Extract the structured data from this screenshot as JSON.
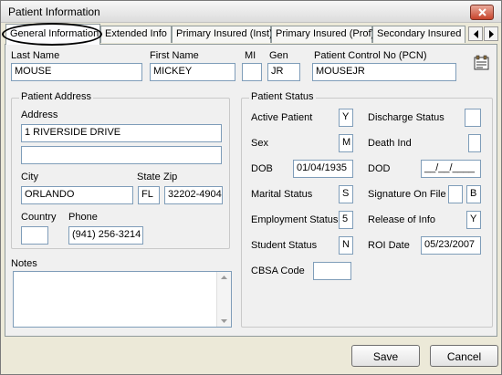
{
  "window": {
    "title": "Patient Information"
  },
  "tabs": [
    {
      "label": "General Information",
      "active": true
    },
    {
      "label": "Extended Info"
    },
    {
      "label": "Primary Insured (Inst)"
    },
    {
      "label": "Primary Insured (Prof)"
    },
    {
      "label": "Secondary Insured"
    }
  ],
  "name_row": {
    "last_name_label": "Last Name",
    "last_name": "MOUSE",
    "first_name_label": "First Name",
    "first_name": "MICKEY",
    "mi_label": "MI",
    "mi": "",
    "gen_label": "Gen",
    "gen": "JR",
    "pcn_label": "Patient Control No (PCN)",
    "pcn": "MOUSEJR"
  },
  "address": {
    "group_title": "Patient Address",
    "address_label": "Address",
    "address_line1": "1 RIVERSIDE DRIVE",
    "address_line2": "",
    "city_label": "City",
    "city": "ORLANDO",
    "state_label": "State",
    "state": "FL",
    "zip_label": "Zip",
    "zip": "32202-4904",
    "country_label": "Country",
    "country": "",
    "phone_label": "Phone",
    "phone": "(941) 256-3214"
  },
  "notes": {
    "label": "Notes",
    "value": ""
  },
  "status": {
    "group_title": "Patient Status",
    "active_label": "Active Patient",
    "active": "Y",
    "discharge_label": "Discharge Status",
    "discharge": "",
    "sex_label": "Sex",
    "sex": "M",
    "death_label": "Death Ind",
    "death": "",
    "dob_label": "DOB",
    "dob": "01/04/1935",
    "dod_label": "DOD",
    "dod": "__/__/____",
    "marital_label": "Marital Status",
    "marital": "S",
    "signature_label": "Signature On File",
    "signature_a": "",
    "signature_b": "B",
    "employment_label": "Employment Status",
    "employment": "5",
    "release_label": "Release of Info",
    "release": "Y",
    "student_label": "Student Status",
    "student": "N",
    "roi_label": "ROI Date",
    "roi": "05/23/2007",
    "cbsa_label": "CBSA Code",
    "cbsa": ""
  },
  "buttons": {
    "save": "Save",
    "cancel": "Cancel"
  }
}
